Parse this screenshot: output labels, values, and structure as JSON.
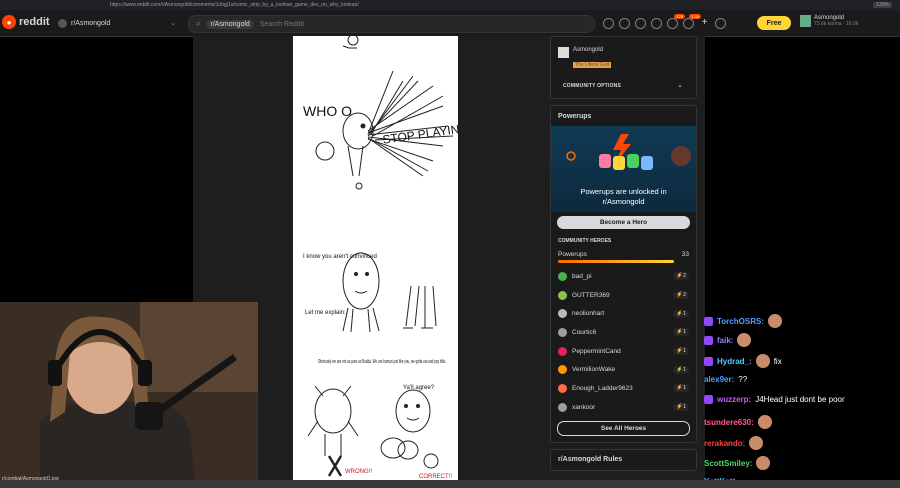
{
  "browser": {
    "url": "https://www.reddit.com/r/Asmongold/comments/1obgj1s/comic_strip_by_a_konkan_game_dev_on_why_konkan/",
    "zoom": "133%"
  },
  "header": {
    "logo_text": "reddit",
    "logo_icon": "reddit-alien-icon",
    "subreddit": "r/Asmongold",
    "search_chip": "r/Asmongold",
    "search_placeholder": "Search Reddit",
    "chat_badge": "129",
    "notif_badge": "1.4k",
    "free_label": "Free",
    "username": "Asmongold",
    "karma": "73.6k karma",
    "gold": "16.0k"
  },
  "comic": {
    "whoo": "WHO O",
    "stop_playing": "STOP PLAYING",
    "know_you": "I know you aren't convinced",
    "let_explain": "Let me explain:",
    "obviously": "Obviously we are not as pure as Budda. We are human just like you, we gotta eat and pay bills.",
    "yall_agree": "Ya'll agree?",
    "wrong": "WRONG!!",
    "correct": "CORRECT!!"
  },
  "sidebar": {
    "mod_name": "Asmongold",
    "mod_flair": "The Literal God",
    "community_options": "COMMUNITY OPTIONS",
    "powerups_title": "Powerups",
    "powerups_banner_line1": "Powerups are unlocked in",
    "powerups_banner_line2": "r/Asmongold",
    "become_hero": "Become a Hero",
    "community_heroes": "COMMUNITY HEROES",
    "powerups_label": "Powerups",
    "powerups_count": "33",
    "powerups_progress": 0.97,
    "heroes": [
      {
        "name": "bad_pi",
        "count": "2",
        "color": "#4caf50"
      },
      {
        "name": "GUTTER369",
        "count": "2",
        "color": "#8bc34a"
      },
      {
        "name": "neolionhart",
        "count": "1",
        "color": "#bbbbbb"
      },
      {
        "name": "Courtic6",
        "count": "1",
        "color": "#9e9e9e"
      },
      {
        "name": "PeppermintCand",
        "count": "1",
        "color": "#e91e63"
      },
      {
        "name": "VermilionWake",
        "count": "1",
        "color": "#ff9800"
      },
      {
        "name": "Enough_Ladder9623",
        "count": "1",
        "color": "#ff7043"
      },
      {
        "name": "xankoor",
        "count": "1",
        "color": "#9e9e9e"
      }
    ],
    "see_all": "See All Heroes",
    "rules_title": "r/Asmongold Rules"
  },
  "webcam": {
    "caption": "r/combat/Asmongold1.jpg"
  },
  "chat": [
    {
      "user": "TorchOSRS:",
      "text": "",
      "color": "#5b9cff",
      "badge": true,
      "emote": true
    },
    {
      "user": "faik:",
      "text": "",
      "color": "#8a7cff",
      "badge": true,
      "emote": true
    },
    {
      "user": "Hydrad_:",
      "text": "fix",
      "color": "#5bc8ff",
      "badge": true,
      "emote": true
    },
    {
      "user": "alex9er:",
      "text": "??",
      "color": "#4aa3ff",
      "badge": false,
      "emote": false
    },
    {
      "user": "wuzzerp:",
      "text": "J4Head just dont be poor",
      "color": "#c55cff",
      "badge": true,
      "emote": false
    },
    {
      "user": "tsundere630:",
      "text": "",
      "color": "#ff5c8a",
      "badge": false,
      "emote": true
    },
    {
      "user": "rerakando:",
      "text": "",
      "color": "#ff4040",
      "badge": false,
      "emote": true
    },
    {
      "user": "ScottSmiley:",
      "text": "",
      "color": "#4cd96b",
      "badge": false,
      "emote": true
    },
    {
      "user": "KattKatt",
      "text": "",
      "color": "#4ab0ff",
      "badge": false,
      "emote": false
    }
  ]
}
